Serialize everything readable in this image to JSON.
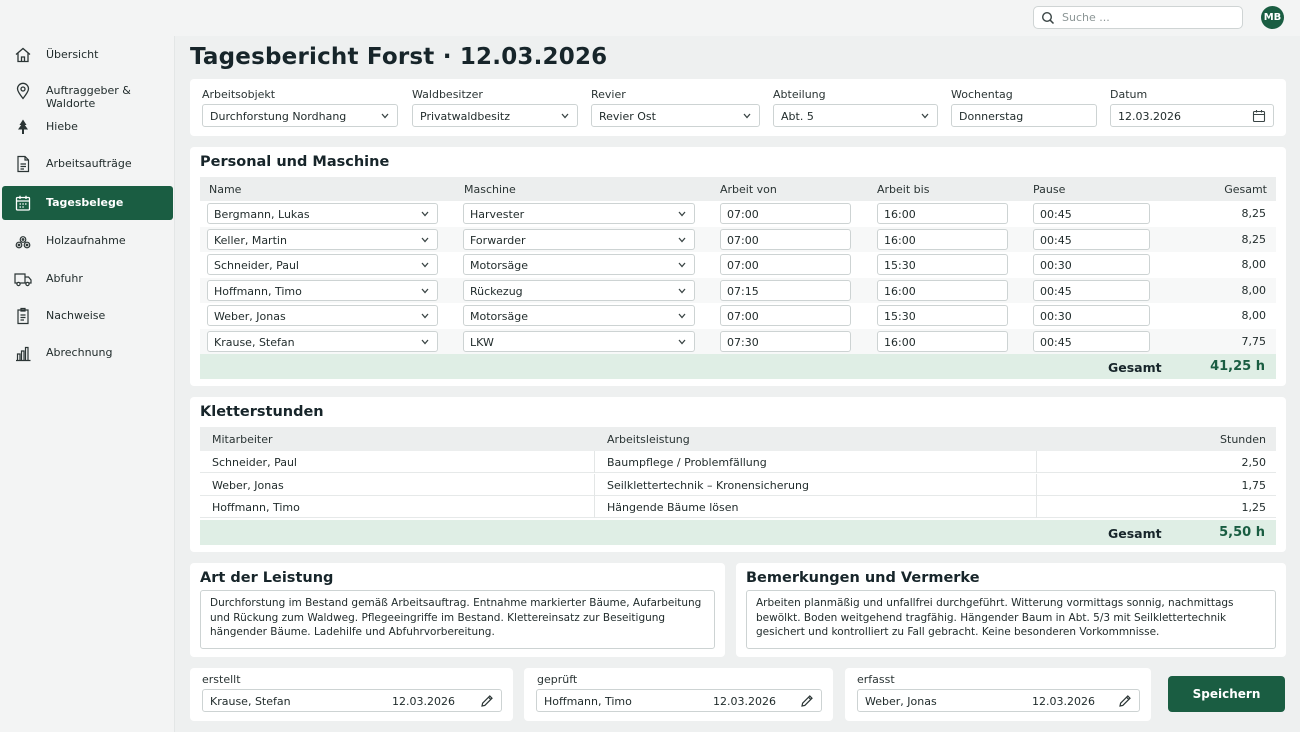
{
  "search": {
    "placeholder": "Suche ..."
  },
  "user": {
    "initials": "MB"
  },
  "sidebar": {
    "items": [
      {
        "label": "Übersicht",
        "icon": "home-icon"
      },
      {
        "label": "Auftraggeber & Waldorte",
        "icon": "location-pin-icon"
      },
      {
        "label": "Hiebe",
        "icon": "tree-icon"
      },
      {
        "label": "Arbeitsaufträge",
        "icon": "document-icon"
      },
      {
        "label": "Tagesbelege",
        "icon": "calendar-icon",
        "active": true
      },
      {
        "label": "Holzaufnahme",
        "icon": "log-pile-icon"
      },
      {
        "label": "Abfuhr",
        "icon": "truck-icon"
      },
      {
        "label": "Nachweise",
        "icon": "clipboard-icon"
      },
      {
        "label": "Abrechnung",
        "icon": "bar-chart-icon"
      }
    ]
  },
  "page": {
    "title": "Tagesbericht Forst · 12.03.2026"
  },
  "header_fields": {
    "arbeitsobjekt": {
      "label": "Arbeitsobjekt",
      "value": "Durchforstung Nordhang"
    },
    "waldbesitzer": {
      "label": "Waldbesitzer",
      "value": "Privatwaldbesitz"
    },
    "revier": {
      "label": "Revier",
      "value": "Revier Ost"
    },
    "abteilung": {
      "label": "Abteilung",
      "value": "Abt. 5"
    },
    "wochentag": {
      "label": "Wochentag",
      "value": "Donnerstag"
    },
    "datum": {
      "label": "Datum",
      "value": "12.03.2026"
    }
  },
  "personal": {
    "title": "Personal und Maschine",
    "columns": [
      "Name",
      "Maschine",
      "Arbeit von",
      "Arbeit bis",
      "Pause",
      "Gesamt"
    ],
    "rows": [
      {
        "name": "Bergmann, Lukas",
        "maschine": "Harvester",
        "von": "07:00",
        "bis": "16:00",
        "pause": "00:45",
        "gesamt": "8,25"
      },
      {
        "name": "Keller, Martin",
        "maschine": "Forwarder",
        "von": "07:00",
        "bis": "16:00",
        "pause": "00:45",
        "gesamt": "8,25"
      },
      {
        "name": "Schneider, Paul",
        "maschine": "Motorsäge",
        "von": "07:00",
        "bis": "15:30",
        "pause": "00:30",
        "gesamt": "8,00"
      },
      {
        "name": "Hoffmann, Timo",
        "maschine": "Rückezug",
        "von": "07:15",
        "bis": "16:00",
        "pause": "00:45",
        "gesamt": "8,00"
      },
      {
        "name": "Weber, Jonas",
        "maschine": "Motorsäge",
        "von": "07:00",
        "bis": "15:30",
        "pause": "00:30",
        "gesamt": "8,00"
      },
      {
        "name": "Krause, Stefan",
        "maschine": "LKW",
        "von": "07:30",
        "bis": "16:00",
        "pause": "00:45",
        "gesamt": "7,75"
      }
    ],
    "total_label": "Gesamt",
    "total_value": "41,25 h"
  },
  "klettern": {
    "title": "Kletterstunden",
    "columns": [
      "Mitarbeiter",
      "Arbeitsleistung",
      "Stunden"
    ],
    "rows": [
      {
        "mitarbeiter": "Schneider, Paul",
        "leistung": "Baumpflege / Problemfällung",
        "stunden": "2,50"
      },
      {
        "mitarbeiter": "Weber, Jonas",
        "leistung": "Seilklettertechnik – Kronensicherung",
        "stunden": "1,75"
      },
      {
        "mitarbeiter": "Hoffmann, Timo",
        "leistung": "Hängende Bäume lösen",
        "stunden": "1,25"
      }
    ],
    "total_label": "Gesamt",
    "total_value": "5,50 h"
  },
  "leistung": {
    "title": "Art der Leistung",
    "text": "Durchforstung im Bestand gemäß Arbeitsauftrag. Entnahme markierter Bäume, Aufarbeitung und Rückung zum Waldweg. Pflegeeingriffe im Bestand. Klettereinsatz zur Beseitigung hängender Bäume. Ladehilfe und Abfuhrvorbereitung."
  },
  "bemerkungen": {
    "title": "Bemerkungen und Vermerke",
    "text": "Arbeiten planmäßig und unfallfrei durchgeführt. Witterung vormittags sonnig, nachmittags bewölkt. Boden weitgehend tragfähig. Hängender Baum in Abt. 5/3 mit Seilklettertechnik gesichert und kontrolliert zu Fall gebracht. Keine besonderen Vorkommnisse."
  },
  "signoff": {
    "erstellt": {
      "label": "erstellt",
      "name": "Krause, Stefan",
      "date": "12.03.2026"
    },
    "geprueft": {
      "label": "geprüft",
      "name": "Hoffmann, Timo",
      "date": "12.03.2026"
    },
    "erfasst": {
      "label": "erfasst",
      "name": "Weber, Jonas",
      "date": "12.03.2026"
    }
  },
  "actions": {
    "save_label": "Speichern"
  },
  "colors": {
    "accent": "#1a5d42",
    "total_bg": "#dfeee5"
  }
}
